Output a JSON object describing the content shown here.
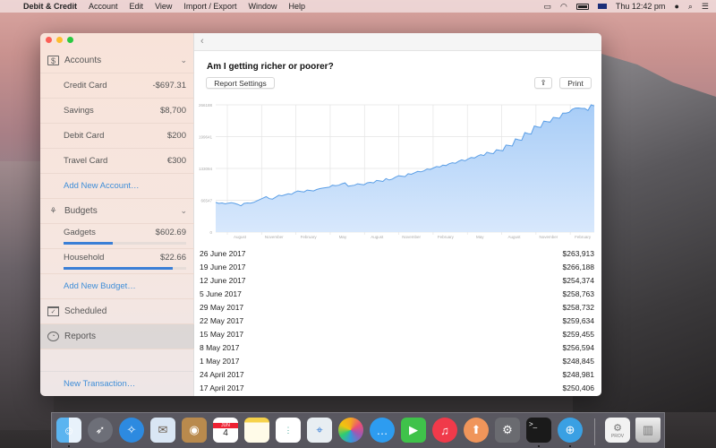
{
  "menubar": {
    "app_name": "Debit & Credit",
    "items": [
      "Account",
      "Edit",
      "View",
      "Import / Export",
      "Window",
      "Help"
    ],
    "clock": "Thu 12:42 pm",
    "status_icons": [
      "airplay-icon",
      "wifi-icon",
      "battery-icon",
      "flag-au-icon",
      "user-icon",
      "spotlight-icon",
      "notification-center-icon"
    ]
  },
  "sidebar": {
    "accounts": {
      "label": "Accounts",
      "items": [
        {
          "name": "Credit Card",
          "balance": "-$697.31"
        },
        {
          "name": "Savings",
          "balance": "$8,700"
        },
        {
          "name": "Debit Card",
          "balance": "$200"
        },
        {
          "name": "Travel Card",
          "balance": "€300"
        }
      ],
      "add_label": "Add New Account…"
    },
    "budgets": {
      "label": "Budgets",
      "items": [
        {
          "name": "Gadgets",
          "amount": "$602.69",
          "progress": 0.4
        },
        {
          "name": "Household",
          "amount": "$22.66",
          "progress": 0.89
        }
      ],
      "add_label": "Add New Budget…"
    },
    "scheduled_label": "Scheduled",
    "reports_label": "Reports",
    "new_transaction_label": "New Transaction…"
  },
  "report": {
    "title": "Am I getting richer or poorer?",
    "settings_label": "Report Settings",
    "print_label": "Print",
    "rows": [
      {
        "date": "26 June 2017",
        "value": "$263,913"
      },
      {
        "date": "19 June 2017",
        "value": "$266,188"
      },
      {
        "date": "12 June 2017",
        "value": "$254,374"
      },
      {
        "date": "5 June 2017",
        "value": "$258,763"
      },
      {
        "date": "29 May 2017",
        "value": "$258,732"
      },
      {
        "date": "22 May 2017",
        "value": "$259,634"
      },
      {
        "date": "15 May 2017",
        "value": "$259,455"
      },
      {
        "date": "8 May 2017",
        "value": "$256,594"
      },
      {
        "date": "1 May 2017",
        "value": "$248,845"
      },
      {
        "date": "24 April 2017",
        "value": "$248,981"
      },
      {
        "date": "17 April 2017",
        "value": "$250,406"
      }
    ]
  },
  "chart_data": {
    "type": "area",
    "title": "",
    "xlabel": "",
    "ylabel": "",
    "ylim": [
      0,
      266188
    ],
    "yticks": [
      0,
      66547,
      133094,
      199641,
      266188
    ],
    "xtick_labels": [
      "August",
      "November",
      "February",
      "May",
      "August",
      "November",
      "February",
      "May",
      "August",
      "November",
      "February"
    ],
    "grid": true,
    "color": "#5a9ee6",
    "fill": "#b9d7fb",
    "values": [
      62000,
      60000,
      61000,
      59000,
      60500,
      61500,
      60000,
      58000,
      55000,
      60000,
      61000,
      60500,
      62000,
      65000,
      68000,
      71000,
      74000,
      70000,
      69000,
      73000,
      77000,
      76000,
      78000,
      80000,
      79000,
      83000,
      86000,
      85000,
      84000,
      88000,
      87000,
      86000,
      89000,
      91000,
      92000,
      93000,
      94000,
      98000,
      97000,
      98000,
      101000,
      103000,
      96000,
      97000,
      98000,
      101000,
      100000,
      99000,
      103000,
      104000,
      103000,
      108000,
      107000,
      106000,
      112000,
      109000,
      111000,
      115000,
      118000,
      117000,
      116000,
      122000,
      121000,
      124000,
      127000,
      126000,
      128000,
      132000,
      131000,
      134000,
      137000,
      136000,
      140000,
      139000,
      143000,
      145000,
      144000,
      148000,
      151000,
      149000,
      153000,
      156000,
      155000,
      159000,
      162000,
      160000,
      167000,
      165000,
      164000,
      172000,
      171000,
      170000,
      182000,
      181000,
      180000,
      195000,
      193000,
      192000,
      208000,
      206000,
      205000,
      222000,
      220000,
      219000,
      232000,
      231000,
      230000,
      240000,
      239000,
      238000,
      248845,
      248981,
      250406,
      256594,
      259455,
      259634,
      258732,
      258763,
      254374,
      266188,
      263913
    ]
  },
  "dock": {
    "apps": [
      "finder-icon",
      "launchpad-icon",
      "safari-icon",
      "mail-icon",
      "contacts-icon",
      "calendar-icon",
      "notes-icon",
      "reminders-icon",
      "maps-icon",
      "photos-icon",
      "messages-icon",
      "facetime-icon",
      "itunes-icon",
      "ibooks-icon",
      "system-preferences-icon",
      "terminal-icon",
      "debit-credit-icon"
    ],
    "calendar_month": "JUN",
    "calendar_day": "4",
    "doc_label": "PROV"
  }
}
